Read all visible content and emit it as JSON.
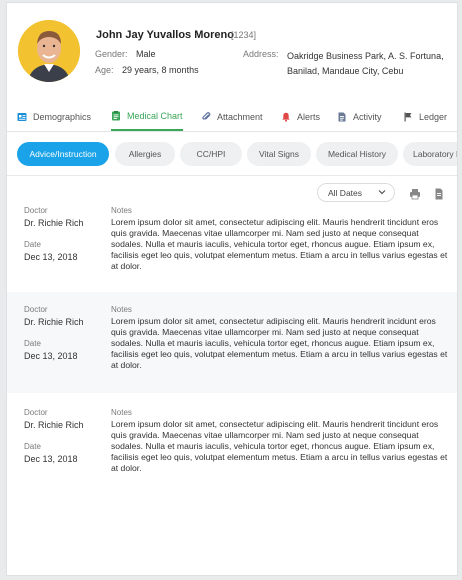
{
  "patient": {
    "name": "John Jay Yuvallos Moreno",
    "id": "[1234]",
    "gender_label": "Gender:",
    "gender": "Male",
    "age_label": "Age:",
    "age": "29 years, 8 months",
    "address_label": "Address:",
    "address": "Oakridge Business Park, A. S. Fortuna, Banilad, Mandaue City, Cebu"
  },
  "tabs": [
    {
      "label": "Demographics",
      "icon": "id-card-icon",
      "active": false
    },
    {
      "label": "Medical Chart",
      "icon": "clipboard-icon",
      "active": true
    },
    {
      "label": "Attachment",
      "icon": "paperclip-icon",
      "active": false
    },
    {
      "label": "Alerts",
      "icon": "bell-icon",
      "active": false
    },
    {
      "label": "Activity",
      "icon": "document-icon",
      "active": false
    },
    {
      "label": "Ledger",
      "icon": "flag-icon",
      "active": false
    }
  ],
  "pills": [
    {
      "label": "Advice/Instruction",
      "active": true
    },
    {
      "label": "Allergies",
      "active": false
    },
    {
      "label": "CC/HPI",
      "active": false
    },
    {
      "label": "Vital Signs",
      "active": false
    },
    {
      "label": "Medical History",
      "active": false
    },
    {
      "label": "Laboratory R",
      "active": false
    }
  ],
  "filter": {
    "selected": "All Dates"
  },
  "colors": {
    "accent_green": "#3aa658",
    "accent_blue": "#1aa3e8",
    "alert_red": "#e04848",
    "avatar_bg": "#f2c230"
  },
  "records": [
    {
      "doctor_label": "Doctor",
      "doctor": "Dr. Richie Rich",
      "date_label": "Date",
      "date": "Dec 13, 2018",
      "notes_label": "Notes",
      "notes": "Lorem ipsum dolor sit amet, consectetur adipiscing elit. Mauris hendrerit tincidunt eros quis gravida. Maecenas vitae ullamcorper mi. Nam sed justo at neque consequat sodales. Nulla et mauris iaculis, vehicula tortor eget, rhoncus augue. Etiam ipsum ex, facilisis eget leo quis, volutpat elementum metus. Etiam a arcu in tellus varius egestas et at dolor."
    },
    {
      "doctor_label": "Doctor",
      "doctor": "Dr. Richie Rich",
      "date_label": "Date",
      "date": "Dec 13, 2018",
      "notes_label": "Notes",
      "notes": "Lorem ipsum dolor sit amet, consectetur adipiscing elit. Mauris hendrerit incidunt eros quis gravida. Maecenas vitae ullamcorper mi. Nam sed justo at neque consequat sodales. Nulla et mauris iaculis, vehicula tortor eget, rhoncus augue. Etiam ipsum ex, facilisis eget leo quis, volutpat elementum metus. Etiam a arcu in tellus varius egestas et at dolor."
    },
    {
      "doctor_label": "Doctor",
      "doctor": "Dr. Richie Rich",
      "date_label": "Date",
      "date": "Dec 13, 2018",
      "notes_label": "Notes",
      "notes": "Lorem ipsum dolor sit amet, consectetur adipiscing elit. Mauris hendrerit tincidunt eros quis gravida. Maecenas vitae ullamcorper mi. Nam sed justo at neque consequat sodales. Nulla et mauris iaculis, vehicula tortor eget, rhoncus augue. Etiam ipsum ex, facilisis eget leo quis, volutpat elementum metus. Etiam a arcu in tellus varius egestas et at dolor."
    }
  ]
}
